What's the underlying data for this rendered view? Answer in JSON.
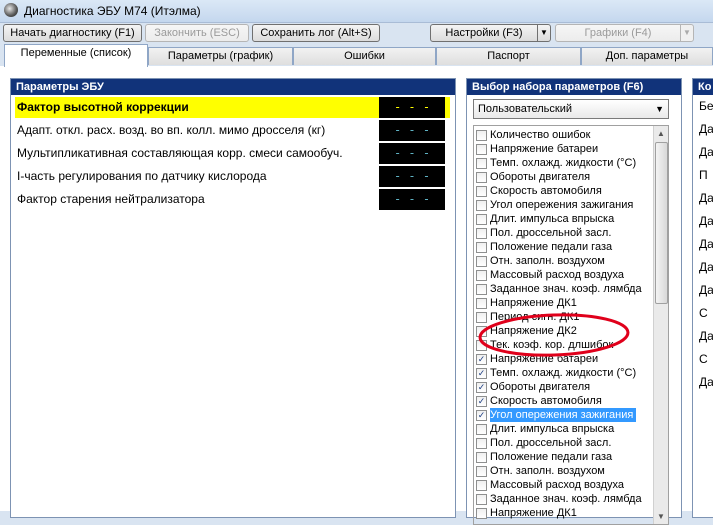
{
  "window": {
    "title": "Диагностика ЭБУ М74 (Итэлма)"
  },
  "toolbar": {
    "start_label": "Начать диагностику (F1)",
    "stop_label": "Закончить (ESC)",
    "save_log_label": "Сохранить лог (Alt+S)",
    "settings_label": "Настройки (F3)",
    "graphs_label": "Графики (F4)"
  },
  "tabs": [
    {
      "label": "Переменные (список)",
      "active": true
    },
    {
      "label": "Параметры (график)"
    },
    {
      "label": "Ошибки"
    },
    {
      "label": "Паспорт"
    },
    {
      "label": "Доп. параметры"
    }
  ],
  "ecu_params": {
    "header": "Параметры ЭБУ",
    "rows": [
      {
        "name": "Фактор высотной коррекции",
        "value": "- - -",
        "highlighted": true
      },
      {
        "name": "Адапт. откл. расх. возд. во вп. колл. мимо дросселя (кг)",
        "value": "- - -"
      },
      {
        "name": "Мультипликативная составляющая корр. смеси самообуч.",
        "value": "- - -"
      },
      {
        "name": "I-часть регулирования по датчику кислорода",
        "value": "- - -"
      },
      {
        "name": "Фактор старения нейтрализатора",
        "value": "- - -"
      }
    ]
  },
  "param_set": {
    "header": "Выбор набора параметров (F6)",
    "selected": "Пользовательский",
    "items": [
      {
        "label": "Количество ошибок",
        "checked": false
      },
      {
        "label": "Напряжение батареи",
        "checked": false
      },
      {
        "label": "Темп. охлажд. жидкости (°C)",
        "checked": false
      },
      {
        "label": "Обороты двигателя",
        "checked": false
      },
      {
        "label": "Скорость автомобиля",
        "checked": false
      },
      {
        "label": "Угол опережения зажигания",
        "checked": false
      },
      {
        "label": "Длит. импульса впрыска",
        "checked": false
      },
      {
        "label": "Пол. дроссельной засл.",
        "checked": false
      },
      {
        "label": "Положение педали газа",
        "checked": false
      },
      {
        "label": "Отн. заполн. воздухом",
        "checked": false
      },
      {
        "label": "Массовый расход воздуха",
        "checked": false
      },
      {
        "label": "Заданное знач. коэф. лямбда",
        "checked": false
      },
      {
        "label": "Напряжение ДК1",
        "checked": false
      },
      {
        "label": "Период сигн. ДК1",
        "checked": false
      },
      {
        "label": "Напряжение ДК2",
        "checked": false
      },
      {
        "label": "Тек. коэф. кор. длшибок",
        "checked": false
      },
      {
        "label": "Напряжение батареи",
        "checked": true
      },
      {
        "label": "Темп. охлажд. жидкости (°C)",
        "checked": true
      },
      {
        "label": "Обороты двигателя",
        "checked": true
      },
      {
        "label": "Скорость автомобиля",
        "checked": true
      },
      {
        "label": "Угол опережения зажигания",
        "checked": true,
        "selected": true
      },
      {
        "label": "Длит. импульса впрыска",
        "checked": false
      },
      {
        "label": "Пол. дроссельной засл.",
        "checked": false
      },
      {
        "label": "Положение педали газа",
        "checked": false
      },
      {
        "label": "Отн. заполн. воздухом",
        "checked": false
      },
      {
        "label": "Массовый расход воздуха",
        "checked": false
      },
      {
        "label": "Заданное знач. коэф. лямбда",
        "checked": false
      },
      {
        "label": "Напряжение ДК1",
        "checked": false
      }
    ]
  },
  "right_panel": {
    "header": "Ко",
    "items": [
      "Бе",
      "Да",
      "Да",
      "П",
      "Да",
      "Да",
      "Да",
      "Да",
      "Да",
      "С",
      "Да",
      "С",
      "Да"
    ]
  },
  "colors": {
    "header_bg": "#11337a",
    "highlight": "#ffff00",
    "annotation": "#e0001b",
    "selection": "#3399ff"
  }
}
